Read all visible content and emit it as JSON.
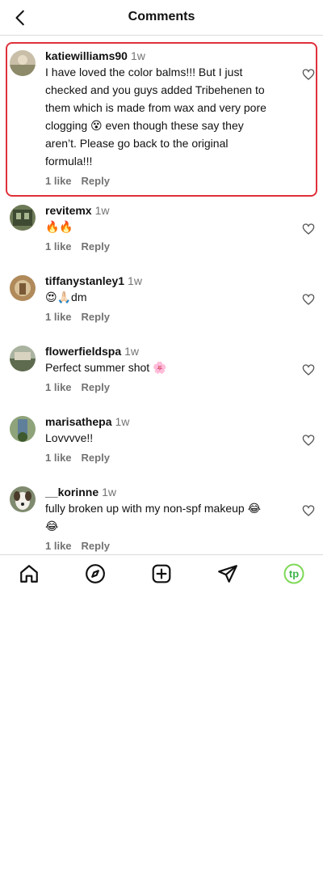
{
  "header": {
    "title": "Comments"
  },
  "comments": [
    {
      "username": "katiewilliams90",
      "time": "1w",
      "text": "I have loved the color balms!!! But I just checked and you guys added Tribehenen to them which is made from wax and very pore clogging 😵 even though these say they aren’t. Please go back to the original formula!!!",
      "likes": "1 like",
      "reply": "Reply"
    },
    {
      "username": "revitemx",
      "time": "1w",
      "text": "🔥🔥",
      "likes": "1 like",
      "reply": "Reply"
    },
    {
      "username": "tiffanystanley1",
      "time": "1w",
      "text": "😍🙏🏻dm",
      "likes": "1 like",
      "reply": "Reply"
    },
    {
      "username": "flowerfieldspa",
      "time": "1w",
      "text": "Perfect summer shot 🌸",
      "likes": "1 like",
      "reply": "Reply"
    },
    {
      "username": "marisathepa",
      "time": "1w",
      "text": "Lovvvve!!",
      "likes": "1 like",
      "reply": "Reply"
    },
    {
      "username": "__korinne",
      "time": "1w",
      "text": "fully broken up with my non-spf makeup 😂😂",
      "likes": "1 like",
      "reply": "Reply"
    }
  ],
  "nav": {
    "items": [
      "home-icon",
      "explore-icon",
      "create-icon",
      "messages-icon",
      "profile-icon"
    ],
    "profile_initials": "tp"
  },
  "colors": {
    "highlight": "#e0303a",
    "profile_ring": "#7ed957",
    "secondary_text": "#737373"
  }
}
